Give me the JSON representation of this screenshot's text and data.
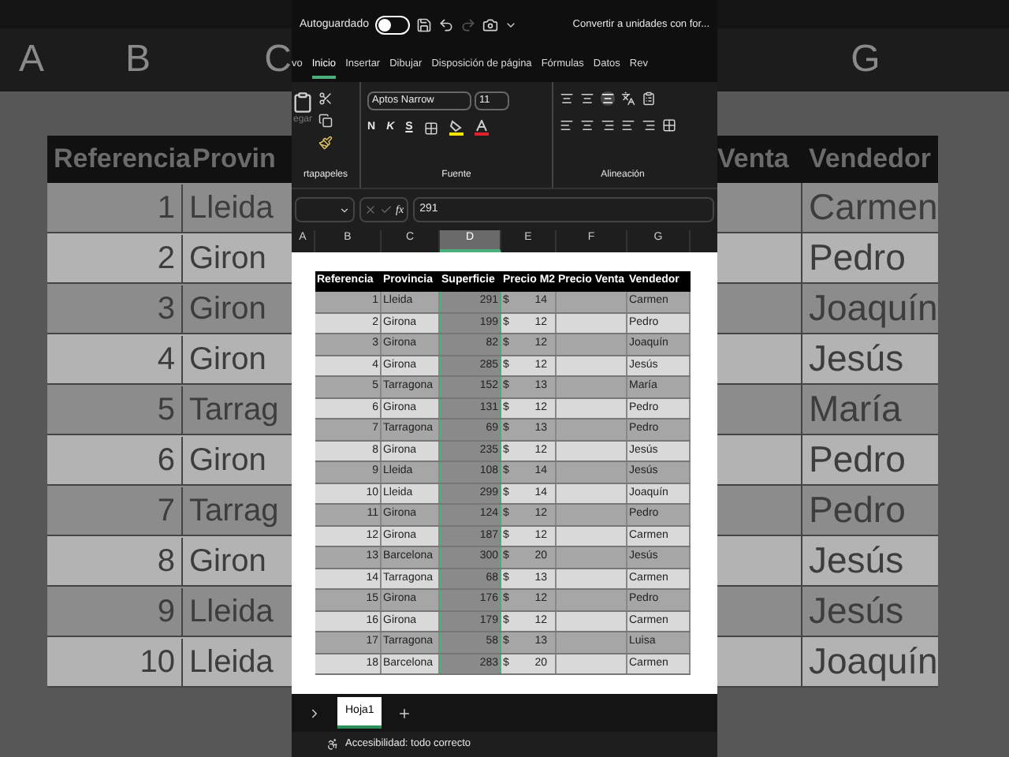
{
  "background": {
    "left": {
      "column_letters": [
        "A",
        "B",
        "C"
      ],
      "header": [
        "Referencia",
        "Provin"
      ],
      "rows": [
        [
          "1",
          "Lleida"
        ],
        [
          "2",
          "Giron"
        ],
        [
          "3",
          "Giron"
        ],
        [
          "4",
          "Giron"
        ],
        [
          "5",
          "Tarrag"
        ],
        [
          "6",
          "Giron"
        ],
        [
          "7",
          "Tarrag"
        ],
        [
          "8",
          "Giron"
        ],
        [
          "9",
          "Lleida"
        ],
        [
          "10",
          "Lleida"
        ]
      ]
    },
    "right": {
      "column_letters": [
        "G"
      ],
      "header": [
        "Venta",
        "Vendedor"
      ],
      "rows": [
        "Carmen",
        "Pedro",
        "Joaquín",
        "Jesús",
        "María",
        "Pedro",
        "Pedro",
        "Jesús",
        "Jesús",
        "Joaquín"
      ]
    }
  },
  "title_bar": {
    "autosave_label": "Autoguardado",
    "autosave_on": false,
    "document_title": "Convertir a unidades con for..."
  },
  "tabs": [
    {
      "label": "vo",
      "selected": false
    },
    {
      "label": "Inicio",
      "selected": true
    },
    {
      "label": "Insertar",
      "selected": false
    },
    {
      "label": "Dibujar",
      "selected": false
    },
    {
      "label": "Disposición de página",
      "selected": false
    },
    {
      "label": "Fórmulas",
      "selected": false
    },
    {
      "label": "Datos",
      "selected": false
    },
    {
      "label": "Rev",
      "selected": false
    }
  ],
  "ribbon": {
    "paste_label": "egar",
    "font_name": "Aptos Narrow",
    "font_size": "11",
    "bold": "N",
    "italic": "K",
    "underline": "S",
    "groups": [
      "rtapapeles",
      "Fuente",
      "Alineación"
    ]
  },
  "formula_bar": {
    "function_label": "fx",
    "value": "291"
  },
  "columns": [
    {
      "letter": "A",
      "selected": false
    },
    {
      "letter": "B",
      "selected": false
    },
    {
      "letter": "C",
      "selected": false
    },
    {
      "letter": "D",
      "selected": true
    },
    {
      "letter": "E",
      "selected": false
    },
    {
      "letter": "F",
      "selected": false
    },
    {
      "letter": "G",
      "selected": false
    }
  ],
  "table": {
    "headers": [
      "Referencia",
      "Provincia",
      "Superficie",
      "Precio M2",
      "Precio Venta",
      "Vendedor"
    ],
    "rows": [
      {
        "ref": "1",
        "provincia": "Lleida",
        "superficie": "291",
        "currency": "$",
        "precio_m2": "14",
        "vendedor": "Carmen"
      },
      {
        "ref": "2",
        "provincia": "Girona",
        "superficie": "199",
        "currency": "$",
        "precio_m2": "12",
        "vendedor": "Pedro"
      },
      {
        "ref": "3",
        "provincia": "Girona",
        "superficie": "82",
        "currency": "$",
        "precio_m2": "12",
        "vendedor": "Joaquín"
      },
      {
        "ref": "4",
        "provincia": "Girona",
        "superficie": "285",
        "currency": "$",
        "precio_m2": "12",
        "vendedor": "Jesús"
      },
      {
        "ref": "5",
        "provincia": "Tarragona",
        "superficie": "152",
        "currency": "$",
        "precio_m2": "13",
        "vendedor": "María"
      },
      {
        "ref": "6",
        "provincia": "Girona",
        "superficie": "131",
        "currency": "$",
        "precio_m2": "12",
        "vendedor": "Pedro"
      },
      {
        "ref": "7",
        "provincia": "Tarragona",
        "superficie": "69",
        "currency": "$",
        "precio_m2": "13",
        "vendedor": "Pedro"
      },
      {
        "ref": "8",
        "provincia": "Girona",
        "superficie": "235",
        "currency": "$",
        "precio_m2": "12",
        "vendedor": "Jesús"
      },
      {
        "ref": "9",
        "provincia": "Lleida",
        "superficie": "108",
        "currency": "$",
        "precio_m2": "14",
        "vendedor": "Jesús"
      },
      {
        "ref": "10",
        "provincia": "Lleida",
        "superficie": "299",
        "currency": "$",
        "precio_m2": "14",
        "vendedor": "Joaquín"
      },
      {
        "ref": "11",
        "provincia": "Girona",
        "superficie": "124",
        "currency": "$",
        "precio_m2": "12",
        "vendedor": "Pedro"
      },
      {
        "ref": "12",
        "provincia": "Girona",
        "superficie": "187",
        "currency": "$",
        "precio_m2": "12",
        "vendedor": "Carmen"
      },
      {
        "ref": "13",
        "provincia": "Barcelona",
        "superficie": "300",
        "currency": "$",
        "precio_m2": "20",
        "vendedor": "Jesús"
      },
      {
        "ref": "14",
        "provincia": "Tarragona",
        "superficie": "68",
        "currency": "$",
        "precio_m2": "13",
        "vendedor": "Carmen"
      },
      {
        "ref": "15",
        "provincia": "Girona",
        "superficie": "176",
        "currency": "$",
        "precio_m2": "12",
        "vendedor": "Pedro"
      },
      {
        "ref": "16",
        "provincia": "Girona",
        "superficie": "179",
        "currency": "$",
        "precio_m2": "12",
        "vendedor": "Carmen"
      },
      {
        "ref": "17",
        "provincia": "Tarragona",
        "superficie": "58",
        "currency": "$",
        "precio_m2": "13",
        "vendedor": "Luisa"
      },
      {
        "ref": "18",
        "provincia": "Barcelona",
        "superficie": "283",
        "currency": "$",
        "precio_m2": "20",
        "vendedor": "Carmen"
      }
    ]
  },
  "sheet_tabs": [
    {
      "label": "Hoja1",
      "selected": true
    }
  ],
  "status_bar": {
    "text": "Accesibilidad: todo correcto"
  }
}
